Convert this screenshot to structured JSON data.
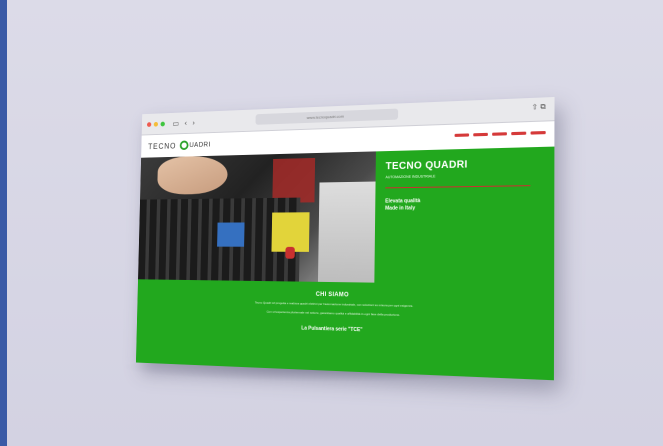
{
  "browser": {
    "url": "www.tecnoquadri.com",
    "nav_back": "‹",
    "nav_forward": "›",
    "sidebar_icon": "▭",
    "share_icon": "⇧",
    "tabs_icon": "⧉"
  },
  "site": {
    "logo_left": "TECNO",
    "logo_right": "UADRI",
    "hero": {
      "title": "TECNO QUADRI",
      "subtitle": "AUTOMAZIONE INDUSTRIALE",
      "tagline_1": "Elevata qualità",
      "tagline_2": "Made in Italy"
    },
    "about": {
      "title": "CHI SIAMO",
      "para_1": "Tecno Quadri srl progetta e realizza quadri elettrici per l'automazione industriale, con soluzioni su misura per ogni esigenza.",
      "para_2": "Con un'esperienza pluriennale nel settore, garantiamo qualità e affidabilità in ogni fase della produzione.",
      "cta": "La Pulsantiera serie \"TCE\""
    }
  },
  "colors": {
    "green": "#22a81e",
    "nav_red": "#d53a3a"
  }
}
